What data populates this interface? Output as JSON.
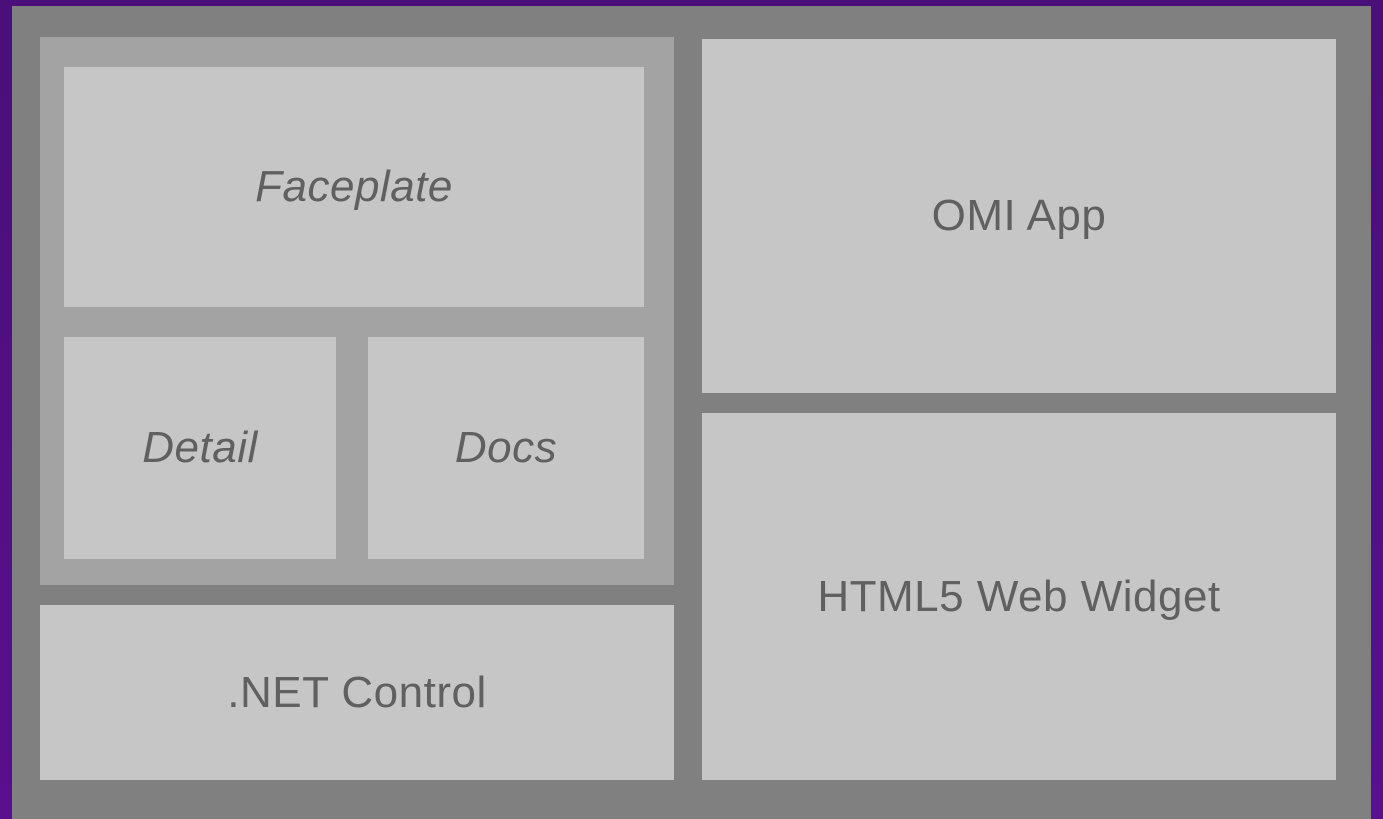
{
  "diagram": {
    "left_group": {
      "faceplate_label": "Faceplate",
      "detail_label": "Detail",
      "docs_label": "Docs"
    },
    "net_control_label": ".NET Control",
    "omi_app_label": "OMI App",
    "html5_widget_label": "HTML5 Web Widget"
  },
  "colors": {
    "frame": "#5a0f8e",
    "canvas": "#808080",
    "group": "#a3a3a3",
    "panel": "#c6c6c6",
    "text": "#606060"
  }
}
